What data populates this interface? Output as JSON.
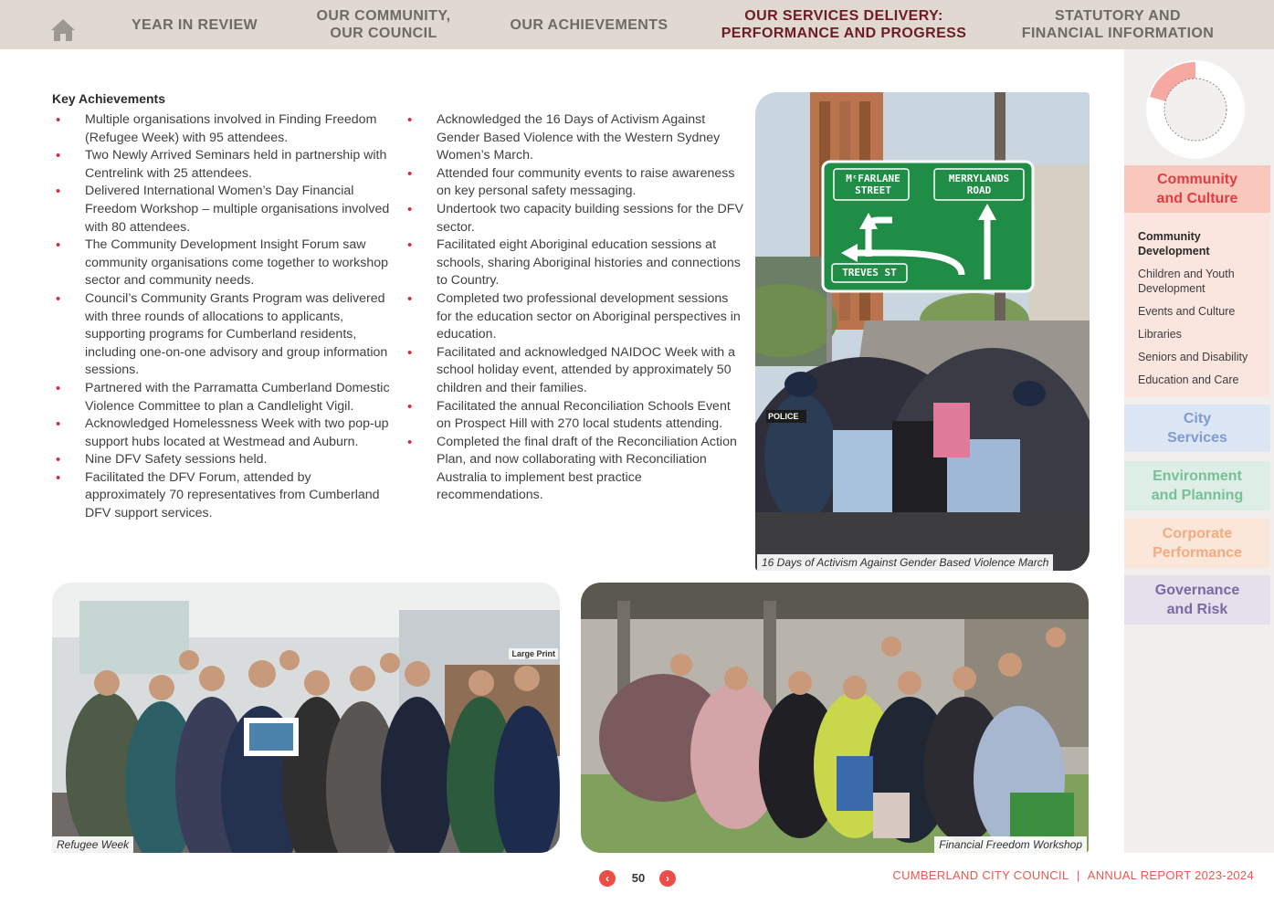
{
  "nav": {
    "home_icon": "home-icon",
    "items": [
      "YEAR IN REVIEW",
      "OUR COMMUNITY,\nOUR COUNCIL",
      "OUR ACHIEVEMENTS",
      "OUR SERVICES DELIVERY:\nPERFORMANCE AND PROGRESS",
      "STATUTORY AND\nFINANCIAL INFORMATION"
    ],
    "active_index": 3
  },
  "content": {
    "heading": "Key Achievements",
    "column1": [
      "Multiple organisations involved in Finding Freedom (Refugee Week) with 95 attendees.",
      "Two Newly Arrived Seminars held in partnership with Centrelink with 25 attendees.",
      "Delivered International Women’s Day Financial Freedom Workshop – multiple organisations involved with 80 attendees.",
      "The Community Development Insight Forum saw community organisations come together to workshop sector and community needs.",
      "Council’s Community Grants Program was delivered with three rounds of allocations to applicants, supporting programs for Cumberland residents, including one-on-one advisory and group information sessions.",
      "Partnered with the Parramatta Cumberland Domestic Violence Committee to plan a Candlelight Vigil.",
      "Acknowledged Homelessness Week with two pop-up support hubs located at Westmead and Auburn.",
      "Nine DFV Safety sessions held.",
      "Facilitated the DFV Forum, attended by approximately 70 representatives from Cumberland DFV support services."
    ],
    "column2": [
      "Acknowledged the 16 Days of Activism Against Gender Based Violence with the Western Sydney Women’s March.",
      "Attended four community events to raise awareness on key personal safety messaging.",
      "Undertook two capacity building sessions for the DFV sector.",
      "Facilitated eight Aboriginal education sessions at schools, sharing Aboriginal histories and connections to Country.",
      "Completed two professional development sessions for the education sector on Aboriginal perspectives in education.",
      "Facilitated and acknowledged NAIDOC Week with a school holiday event, attended by approximately 50 children and their families.",
      "Facilitated the annual Reconciliation Schools Event on Prospect Hill with 270 local students attending.",
      "Completed the final draft of the Reconciliation Action Plan, and now collaborating with Reconciliation Australia to implement best practice recommendations."
    ]
  },
  "photos": {
    "march": {
      "caption": "16 Days of Activism Against Gender Based Violence March",
      "sign_left_top": "MᶜFARLANE",
      "sign_left_bottom": "STREET",
      "sign_right_top": "MERRYLANDS",
      "sign_right_bottom": "ROAD",
      "sign_bottom": "TREVES ST",
      "police_label": "POLICE"
    },
    "refugee": {
      "caption": "Refugee Week",
      "shelf_label": "Large Print"
    },
    "finance": {
      "caption": "Financial Freedom Workshop"
    }
  },
  "sidebar": {
    "categories": [
      "Community\nand Culture",
      "City\nServices",
      "Environment\nand Planning",
      "Corporate\nPerformance",
      "Governance\nand Risk"
    ],
    "subitems": [
      "Community\nDevelopment",
      "Children and Youth\nDevelopment",
      "Events and Culture",
      "Libraries",
      "Seniors and Disability",
      "Education and Care"
    ],
    "active_subitem": 0,
    "colors": {
      "community": "#e33b43",
      "city": "#7e9bd2",
      "environment": "#78bf98",
      "corporate": "#f1ab7f",
      "governance": "#7a6aa3"
    }
  },
  "footer": {
    "page_number": "50",
    "prev_icon": "chevron-left-icon",
    "next_icon": "chevron-right-icon",
    "org": "CUMBERLAND CITY COUNCIL",
    "separator": "|",
    "report": "ANNUAL REPORT 2023-2024"
  }
}
